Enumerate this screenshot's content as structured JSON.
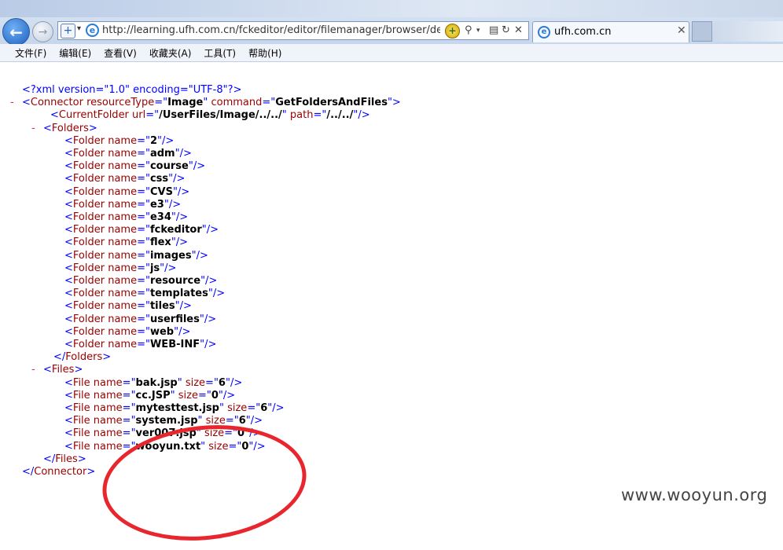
{
  "browser": {
    "address_url": "http://learning.ufh.com.cn/fckeditor/editor/filemanager/browser/default/co",
    "tab_title": "ufh.com.cn"
  },
  "menu": [
    {
      "label": "文件(F)"
    },
    {
      "label": "编辑(E)"
    },
    {
      "label": "查看(V)"
    },
    {
      "label": "收藏夹(A)"
    },
    {
      "label": "工具(T)"
    },
    {
      "label": "帮助(H)"
    }
  ],
  "xml": {
    "declaration": "<?xml version=\"1.0\" encoding=\"UTF-8\"?>",
    "connector": {
      "resourceType": "Image",
      "command": "GetFoldersAndFiles"
    },
    "current_folder": {
      "url": "/UserFiles/Image/../../",
      "path": "/../../"
    },
    "folders": [
      "2",
      "adm",
      "course",
      "css",
      "CVS",
      "e3",
      "e34",
      "fckeditor",
      "flex",
      "images",
      "js",
      "resource",
      "templates",
      "tiles",
      "userfiles",
      "web",
      "WEB-INF"
    ],
    "files": [
      {
        "name": "bak.jsp",
        "size": "6"
      },
      {
        "name": "cc.JSP",
        "size": "0"
      },
      {
        "name": "mytesttest.jsp",
        "size": "6"
      },
      {
        "name": "system.jsp",
        "size": "6"
      },
      {
        "name": "ver007.jsp",
        "size": "0"
      },
      {
        "name": "wooyun.txt",
        "size": "0"
      }
    ],
    "collapse_symbol": "-"
  },
  "watermark": "www.wooyun.org",
  "colors": {
    "markup": "#0000ff",
    "tag": "#990000",
    "collapse": "#e2303a",
    "annotation": "#e8262e"
  }
}
